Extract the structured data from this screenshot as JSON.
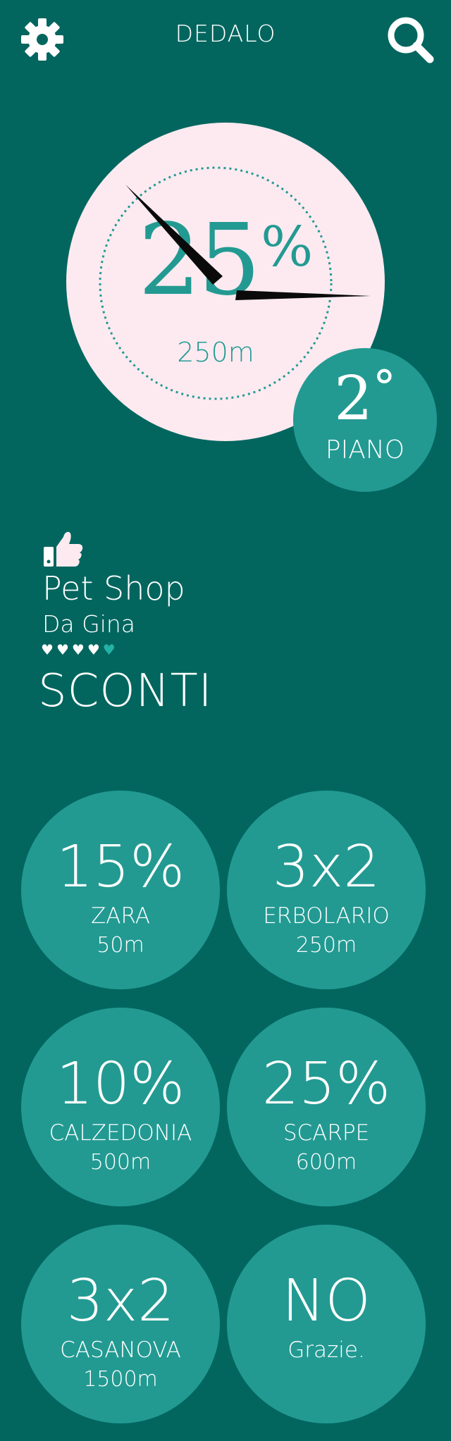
{
  "header": {
    "title": "DEDALO",
    "settings_icon": "gear-icon",
    "search_icon": "search-icon"
  },
  "hero": {
    "percent_value": "25",
    "percent_sign": "%",
    "distance": "250m",
    "floor_number": "2",
    "floor_degree": "°",
    "floor_label": "PIANO"
  },
  "shop": {
    "icon": "thumbs-up-icon",
    "name": "Pet Shop",
    "subtitle": "Da Gina",
    "rating": 4,
    "rating_max": 5
  },
  "section_title": "SCONTI",
  "deals": [
    {
      "value": "15%",
      "name": "ZARA",
      "distance": "50m"
    },
    {
      "value": "3x2",
      "name": "ERBOLARIO",
      "distance": "250m"
    },
    {
      "value": "10%",
      "name": "CALZEDONIA",
      "distance": "500m"
    },
    {
      "value": "25%",
      "name": "SCARPE",
      "distance": "600m"
    },
    {
      "value": "3x2",
      "name": "CASANOVA",
      "distance": "1500m"
    },
    {
      "value": "NO",
      "name": "Grazie.",
      "distance": ""
    }
  ],
  "colors": {
    "background": "#02665f",
    "accent": "#229a92",
    "hero_bg": "#fdeaf0",
    "text": "#ffffff"
  }
}
